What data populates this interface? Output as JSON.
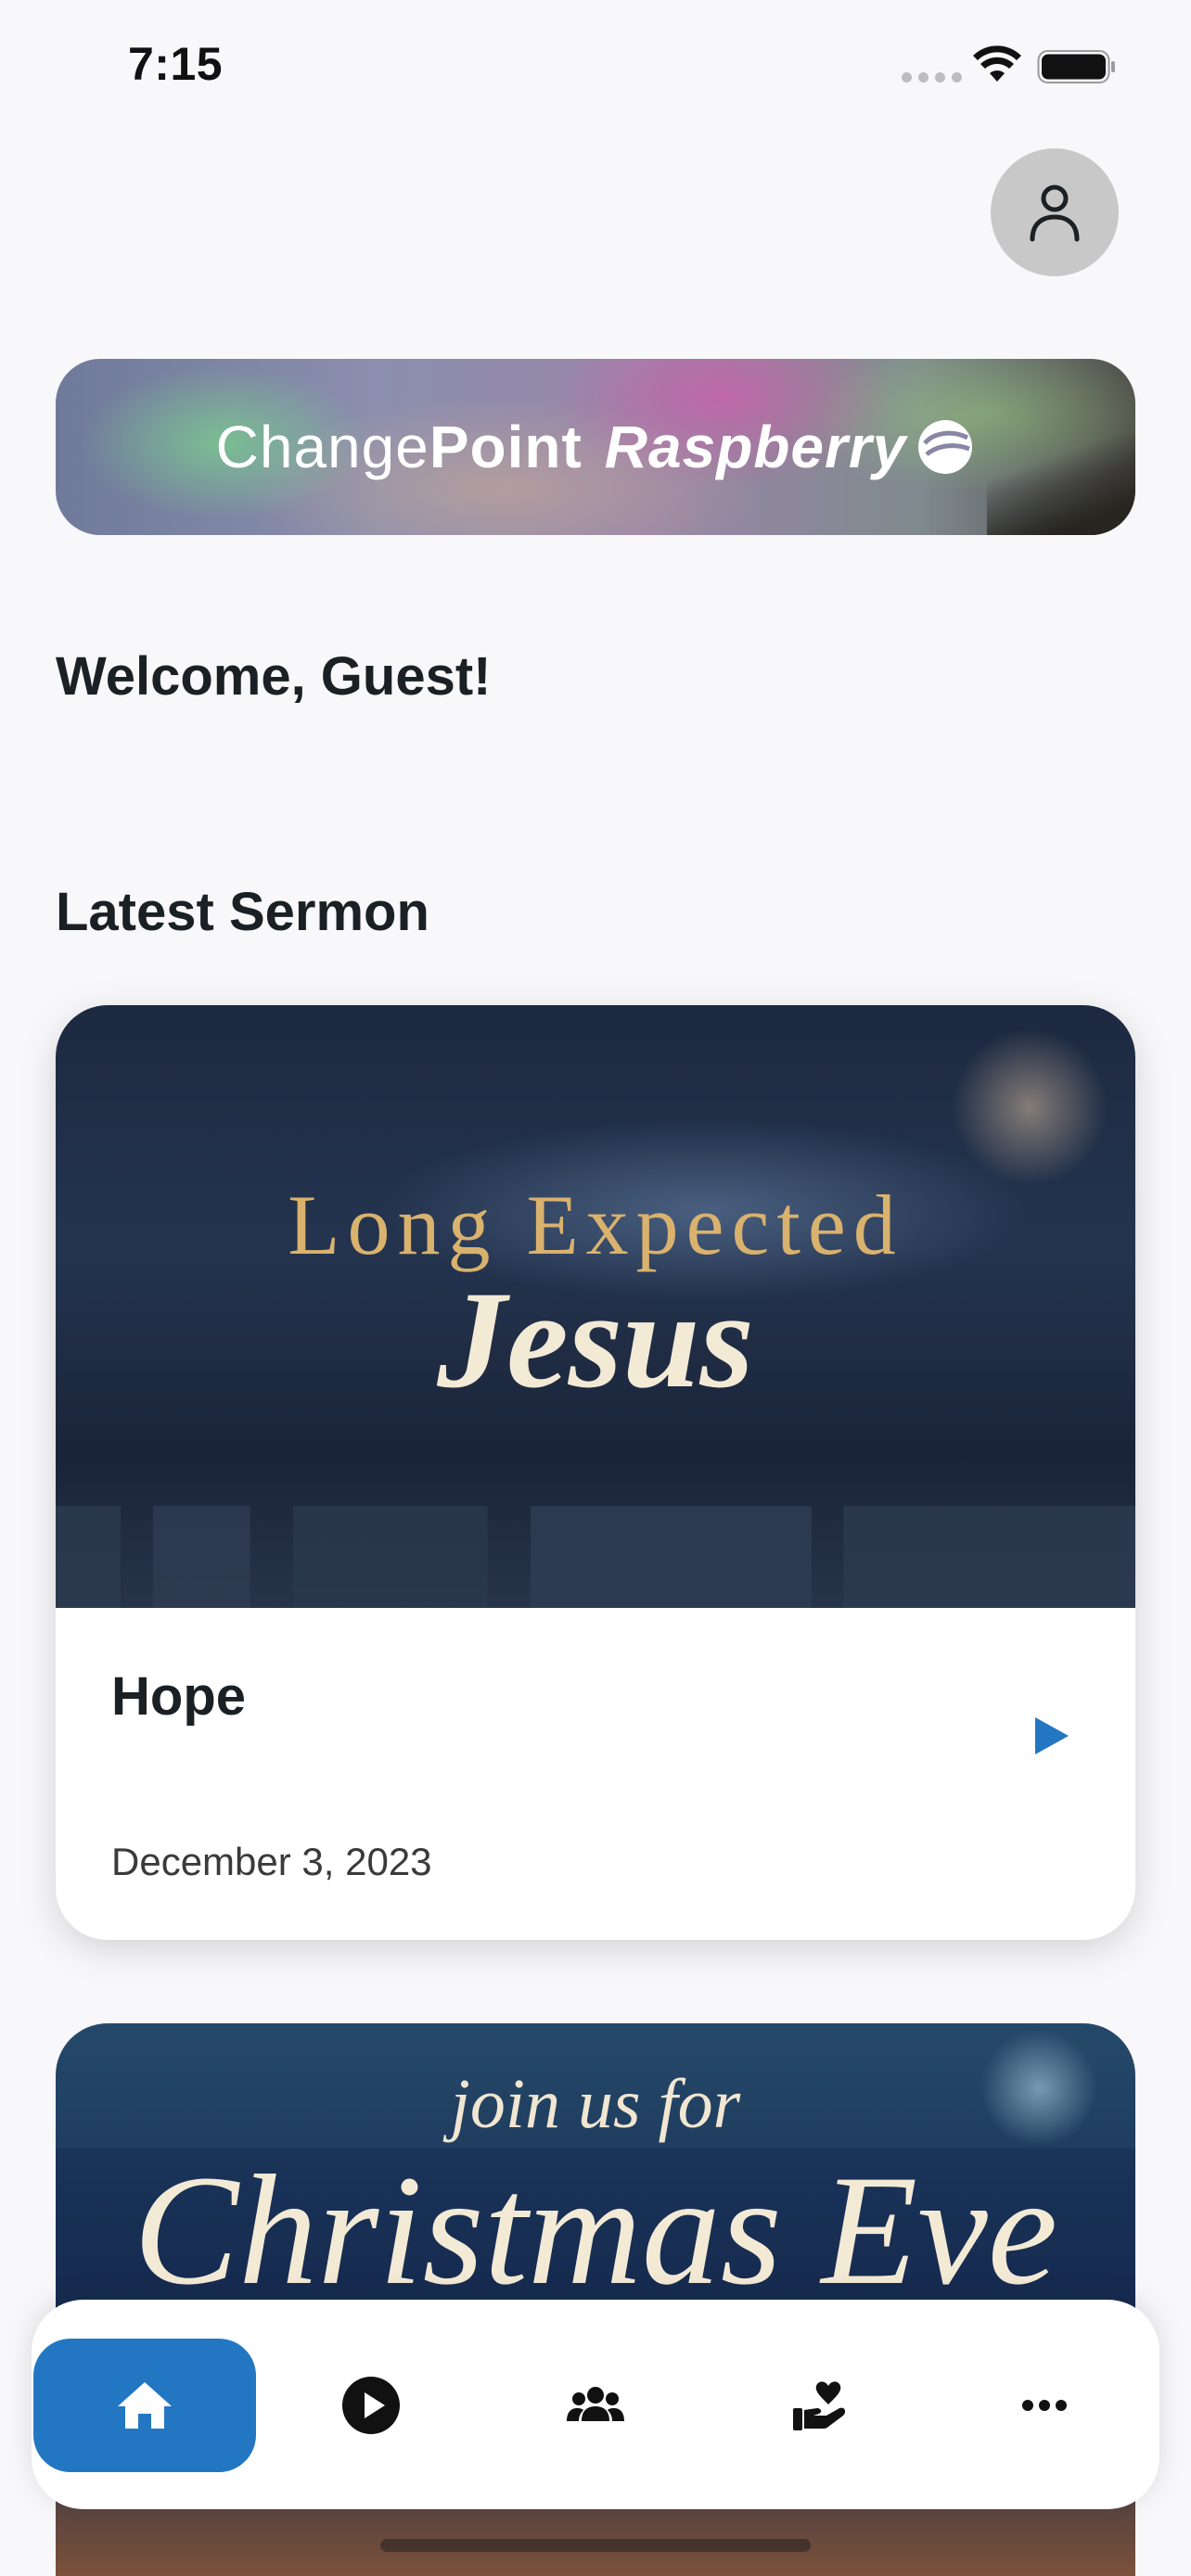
{
  "status_bar": {
    "time": "7:15"
  },
  "banner": {
    "brand_light": "Change",
    "brand_bold": "Point",
    "brand_italic": "Raspberry"
  },
  "welcome_text": "Welcome, Guest!",
  "latest_sermon": {
    "section_title": "Latest Sermon",
    "art_line1": "Long Expected",
    "art_line2": "Jesus",
    "title": "Hope",
    "date": "December 3, 2023"
  },
  "next_card": {
    "art_line1": "join us for",
    "art_line2": "Christmas Eve"
  },
  "tab_bar": {
    "items": [
      {
        "icon": "home-icon",
        "active": true
      },
      {
        "icon": "play-circle-icon",
        "active": false
      },
      {
        "icon": "people-icon",
        "active": false
      },
      {
        "icon": "giving-hand-heart-icon",
        "active": false
      },
      {
        "icon": "more-dots-icon",
        "active": false
      }
    ]
  },
  "colors": {
    "accent": "#2377c2",
    "background": "#f8f8fa",
    "text": "#1b2024"
  }
}
